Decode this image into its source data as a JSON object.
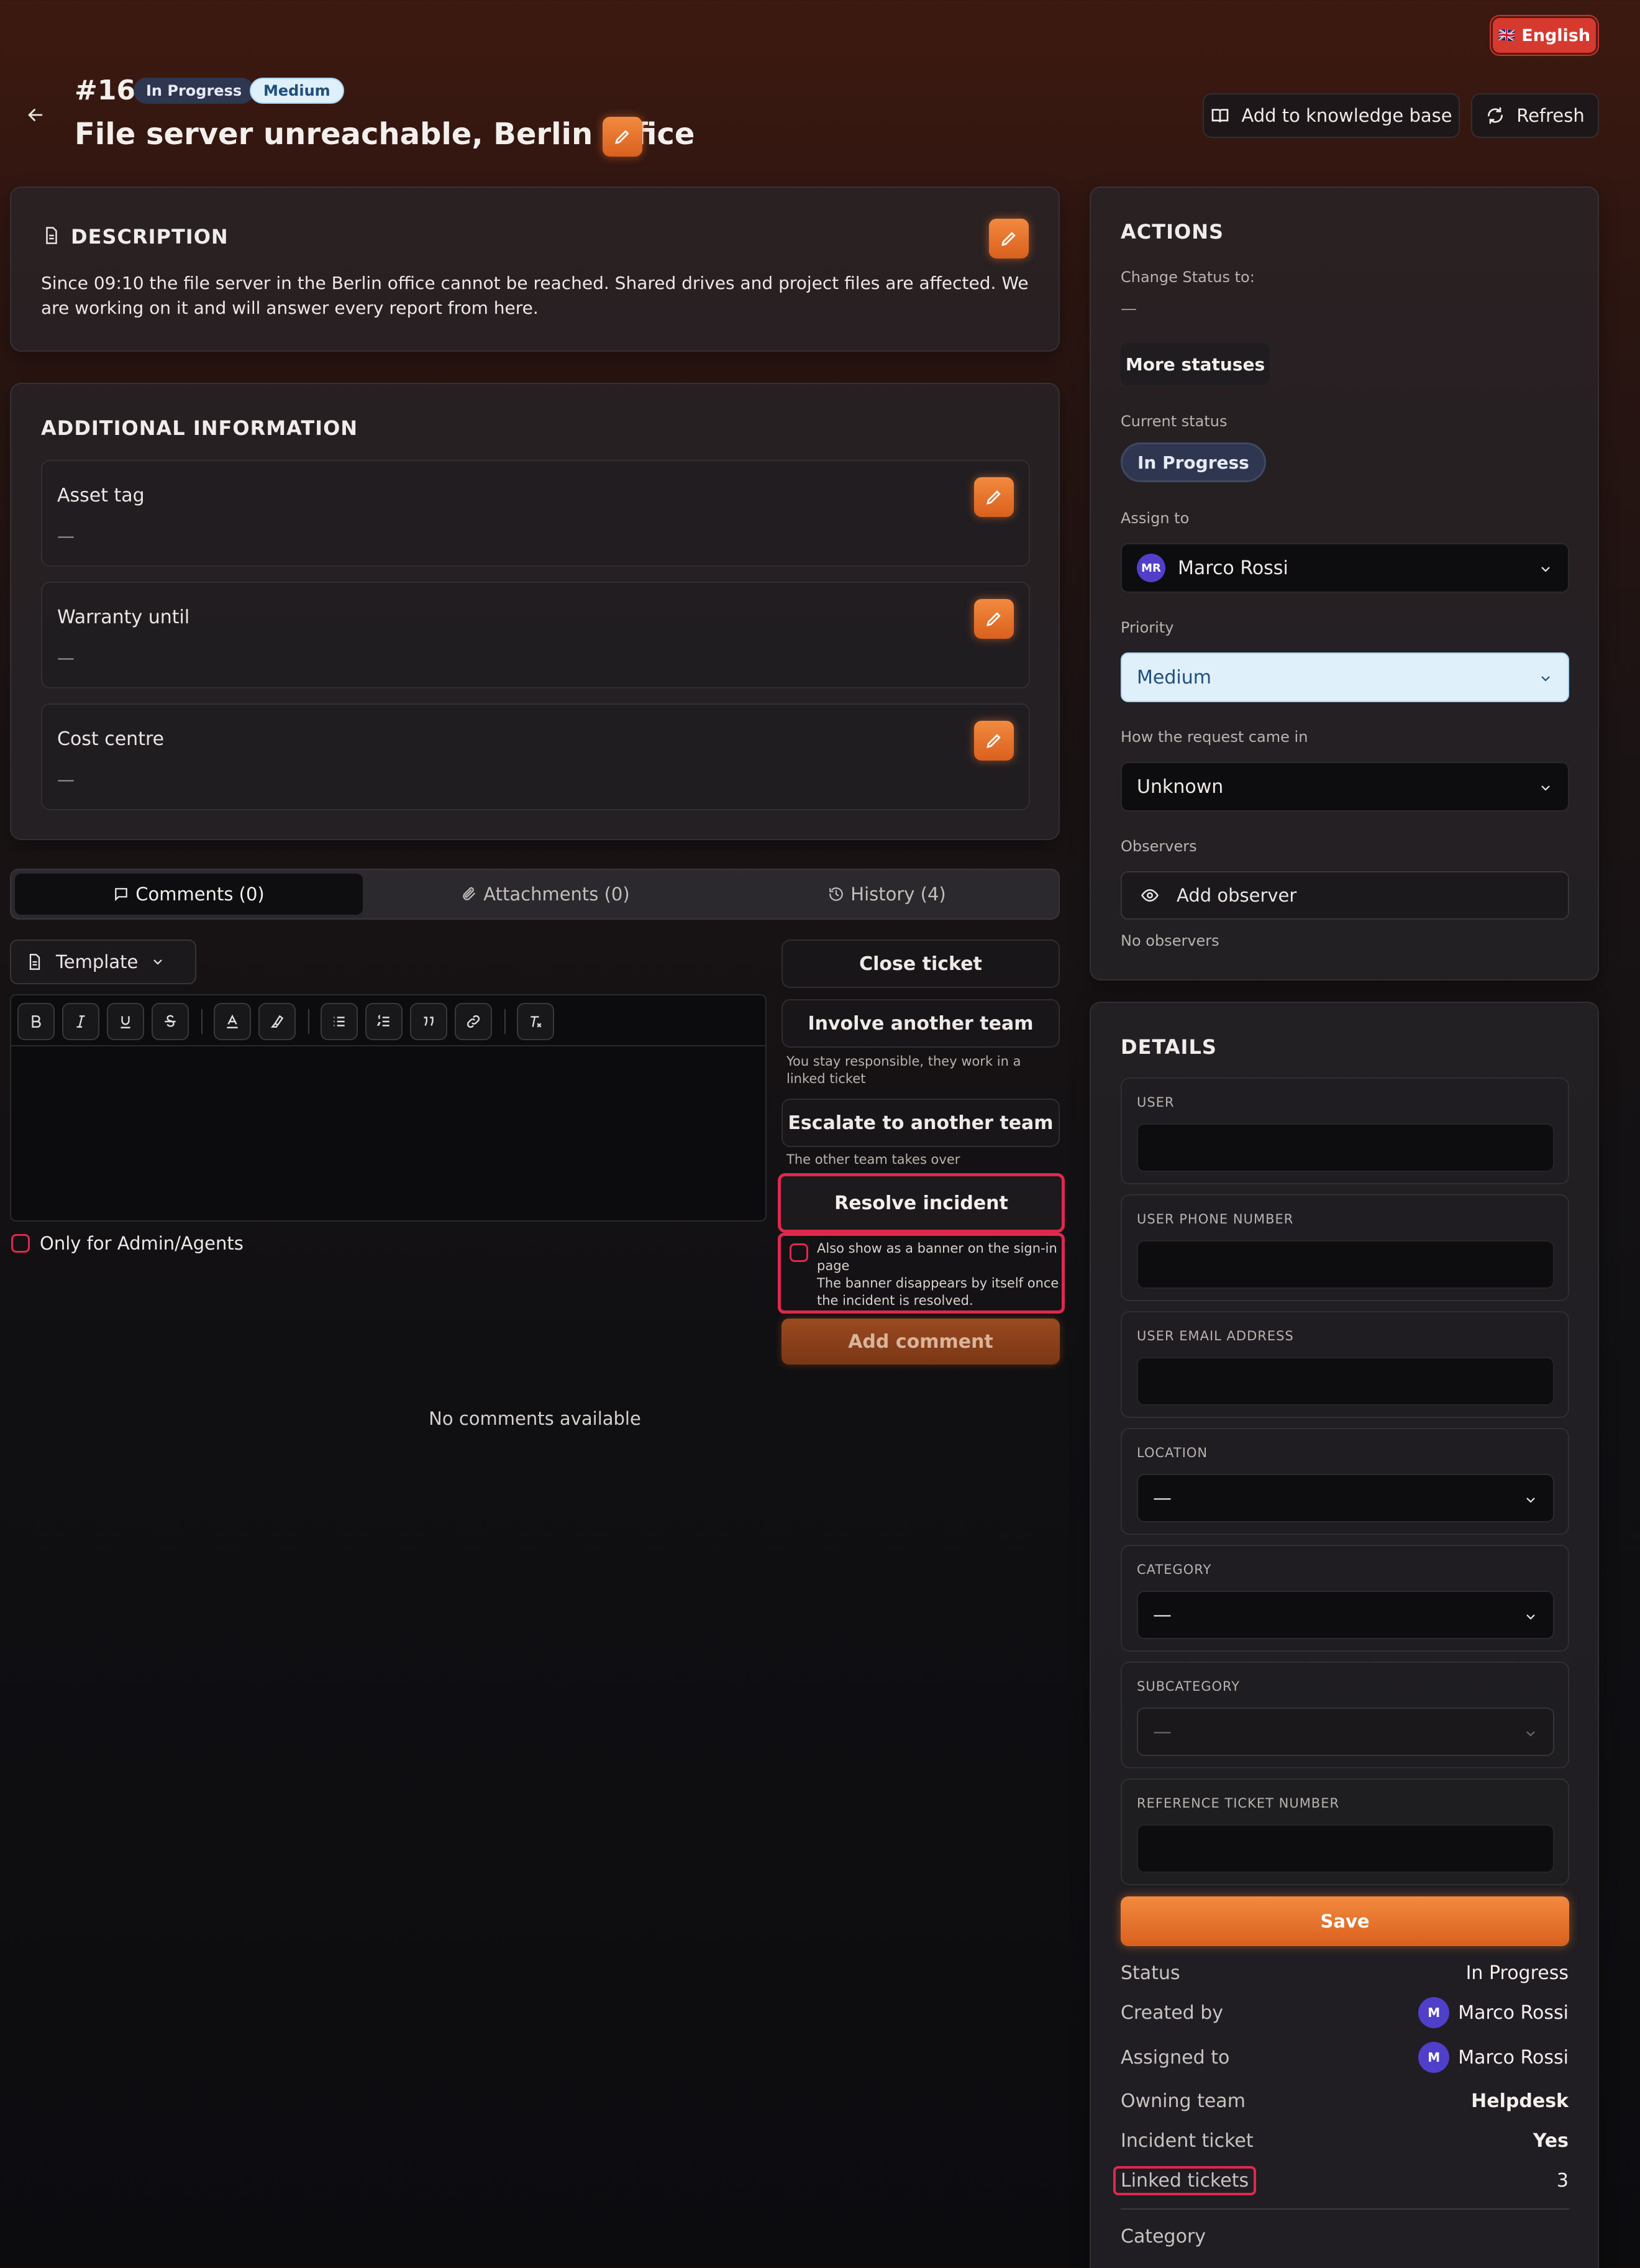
{
  "lang": {
    "label": "English",
    "flag": "🇬🇧"
  },
  "header": {
    "ticket_no": "#16",
    "status_badge": "In Progress",
    "priority_badge": "Medium",
    "title": "File server unreachable, Berlin office",
    "kb_button": "Add to knowledge base",
    "refresh_button": "Refresh"
  },
  "description": {
    "heading": "DESCRIPTION",
    "text": "Since 09:10 the file server in the Berlin office cannot be reached. Shared drives and project files are affected. We are working on it and will answer every report from here."
  },
  "additional": {
    "heading": "ADDITIONAL INFORMATION",
    "fields": [
      {
        "label": "Asset tag",
        "value": "—"
      },
      {
        "label": "Warranty until",
        "value": "—"
      },
      {
        "label": "Cost centre",
        "value": "—"
      }
    ]
  },
  "tabs": [
    {
      "label": "Comments (0)"
    },
    {
      "label": "Attachments (0)"
    },
    {
      "label": "History (4)"
    }
  ],
  "editor": {
    "template_label": "Template",
    "only_admins": "Only for Admin/Agents",
    "no_comments": "No comments available"
  },
  "ticket_actions": {
    "close": "Close ticket",
    "involve": "Involve another team",
    "involve_hint": "You stay responsible, they work in a linked ticket",
    "escalate": "Escalate to another team",
    "escalate_hint": "The other team takes over",
    "resolve": "Resolve incident",
    "banner_line1": "Also show as a banner on the sign-in page",
    "banner_line2": "The banner disappears by itself once the incident is resolved.",
    "add_comment": "Add comment"
  },
  "actions": {
    "heading": "ACTIONS",
    "change_status_label": "Change Status to:",
    "change_status_value": "—",
    "more_statuses": "More statuses",
    "current_status_label": "Current status",
    "current_status": "In Progress",
    "assign_label": "Assign to",
    "assign_initials": "MR",
    "assign_value": "Marco Rossi",
    "priority_label": "Priority",
    "priority_value": "Medium",
    "source_label": "How the request came in",
    "source_value": "Unknown",
    "observers_label": "Observers",
    "add_observer": "Add observer",
    "no_observers": "No observers"
  },
  "details": {
    "heading": "DETAILS",
    "user_label": "USER",
    "phone_label": "USER PHONE NUMBER",
    "email_label": "USER EMAIL ADDRESS",
    "location_label": "LOCATION",
    "location_value": "—",
    "category_label": "CATEGORY",
    "category_value": "—",
    "subcategory_label": "SUBCATEGORY",
    "subcategory_value": "—",
    "reference_label": "REFERENCE TICKET NUMBER",
    "save": "Save",
    "rows": {
      "status_k": "Status",
      "status_v": "In Progress",
      "created_k": "Created by",
      "created_v": "Marco Rossi",
      "created_initial": "M",
      "assigned_k": "Assigned to",
      "assigned_v": "Marco Rossi",
      "assigned_initial": "M",
      "team_k": "Owning team",
      "team_v": "Helpdesk",
      "incident_k": "Incident ticket",
      "incident_v": "Yes",
      "linked_k": "Linked tickets",
      "linked_v": "3",
      "category_k": "Category"
    }
  },
  "colors": {
    "accent": "#e8722c",
    "highlight": "#e0284e",
    "status_badge_bg": "#2e3650",
    "priority_badge_bg": "#dff0fb"
  }
}
